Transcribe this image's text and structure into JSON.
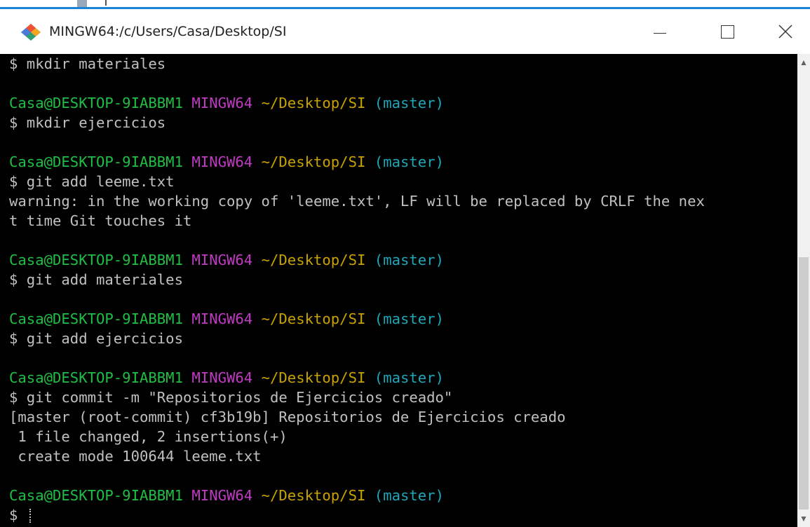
{
  "window": {
    "title": "MINGW64:/c/Users/Casa/Desktop/SI",
    "controls": {
      "minimize": "minimize-icon",
      "maximize": "maximize-icon",
      "close": "close-icon"
    }
  },
  "colors": {
    "user_host": "#1fbf45",
    "system": "#c13ac4",
    "path": "#c8a200",
    "branch": "#1fa6b8",
    "text": "#c0c0c0",
    "accent": "#1883d7"
  },
  "terminal": {
    "prompt": {
      "user_host": "Casa@DESKTOP-9IABBM1",
      "system": "MINGW64",
      "path": "~/Desktop/SI",
      "branch": "(master)"
    },
    "lines": [
      "$ mkdir materiales",
      "",
      "$ mkdir ejercicios",
      "",
      "$ git add leeme.txt",
      "warning: in the working copy of 'leeme.txt', LF will be replaced by CRLF the nex",
      "t time Git touches it",
      "",
      "$ git add materiales",
      "",
      "$ git add ejercicios",
      "",
      "$ git commit -m \"Repositorios de Ejercicios creado\"",
      "[master (root-commit) cf3b19b] Repositorios de Ejercicios creado",
      " 1 file changed, 2 insertions(+)",
      " create mode 100644 leeme.txt",
      "",
      "$ "
    ]
  }
}
